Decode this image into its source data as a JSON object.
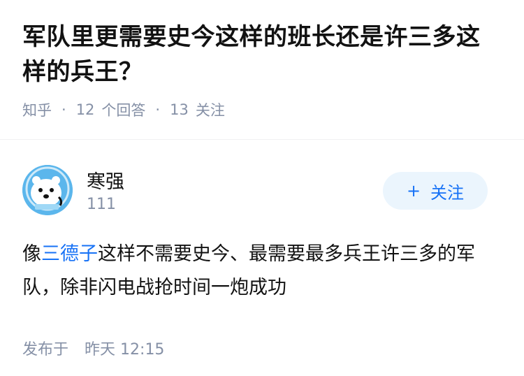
{
  "question": {
    "title": "军队里更需要史今这样的班长还是许三多这样的兵王？",
    "source": "知乎",
    "answer_count": "12",
    "answer_label": "个回答",
    "follow_count": "13",
    "follow_label": "关注"
  },
  "answer": {
    "author_name": "寒强",
    "author_sub": "111",
    "follow_button": "关注",
    "content_before": "像",
    "content_link": "三德子",
    "content_after": "这样不需要史今、最需要最多兵王许三多的军队，除非闪电战抢时间一炮成功",
    "time_label": "发布于",
    "time_day": "昨天",
    "time_clock": "12:15"
  },
  "icons": {
    "avatar": "polar-bear-avatar-icon",
    "plus": "plus-icon"
  },
  "colors": {
    "accent": "#1772f6",
    "muted": "#8590a6",
    "button_bg": "#ebf5fd",
    "avatar_bg": "#5bb6ec"
  }
}
